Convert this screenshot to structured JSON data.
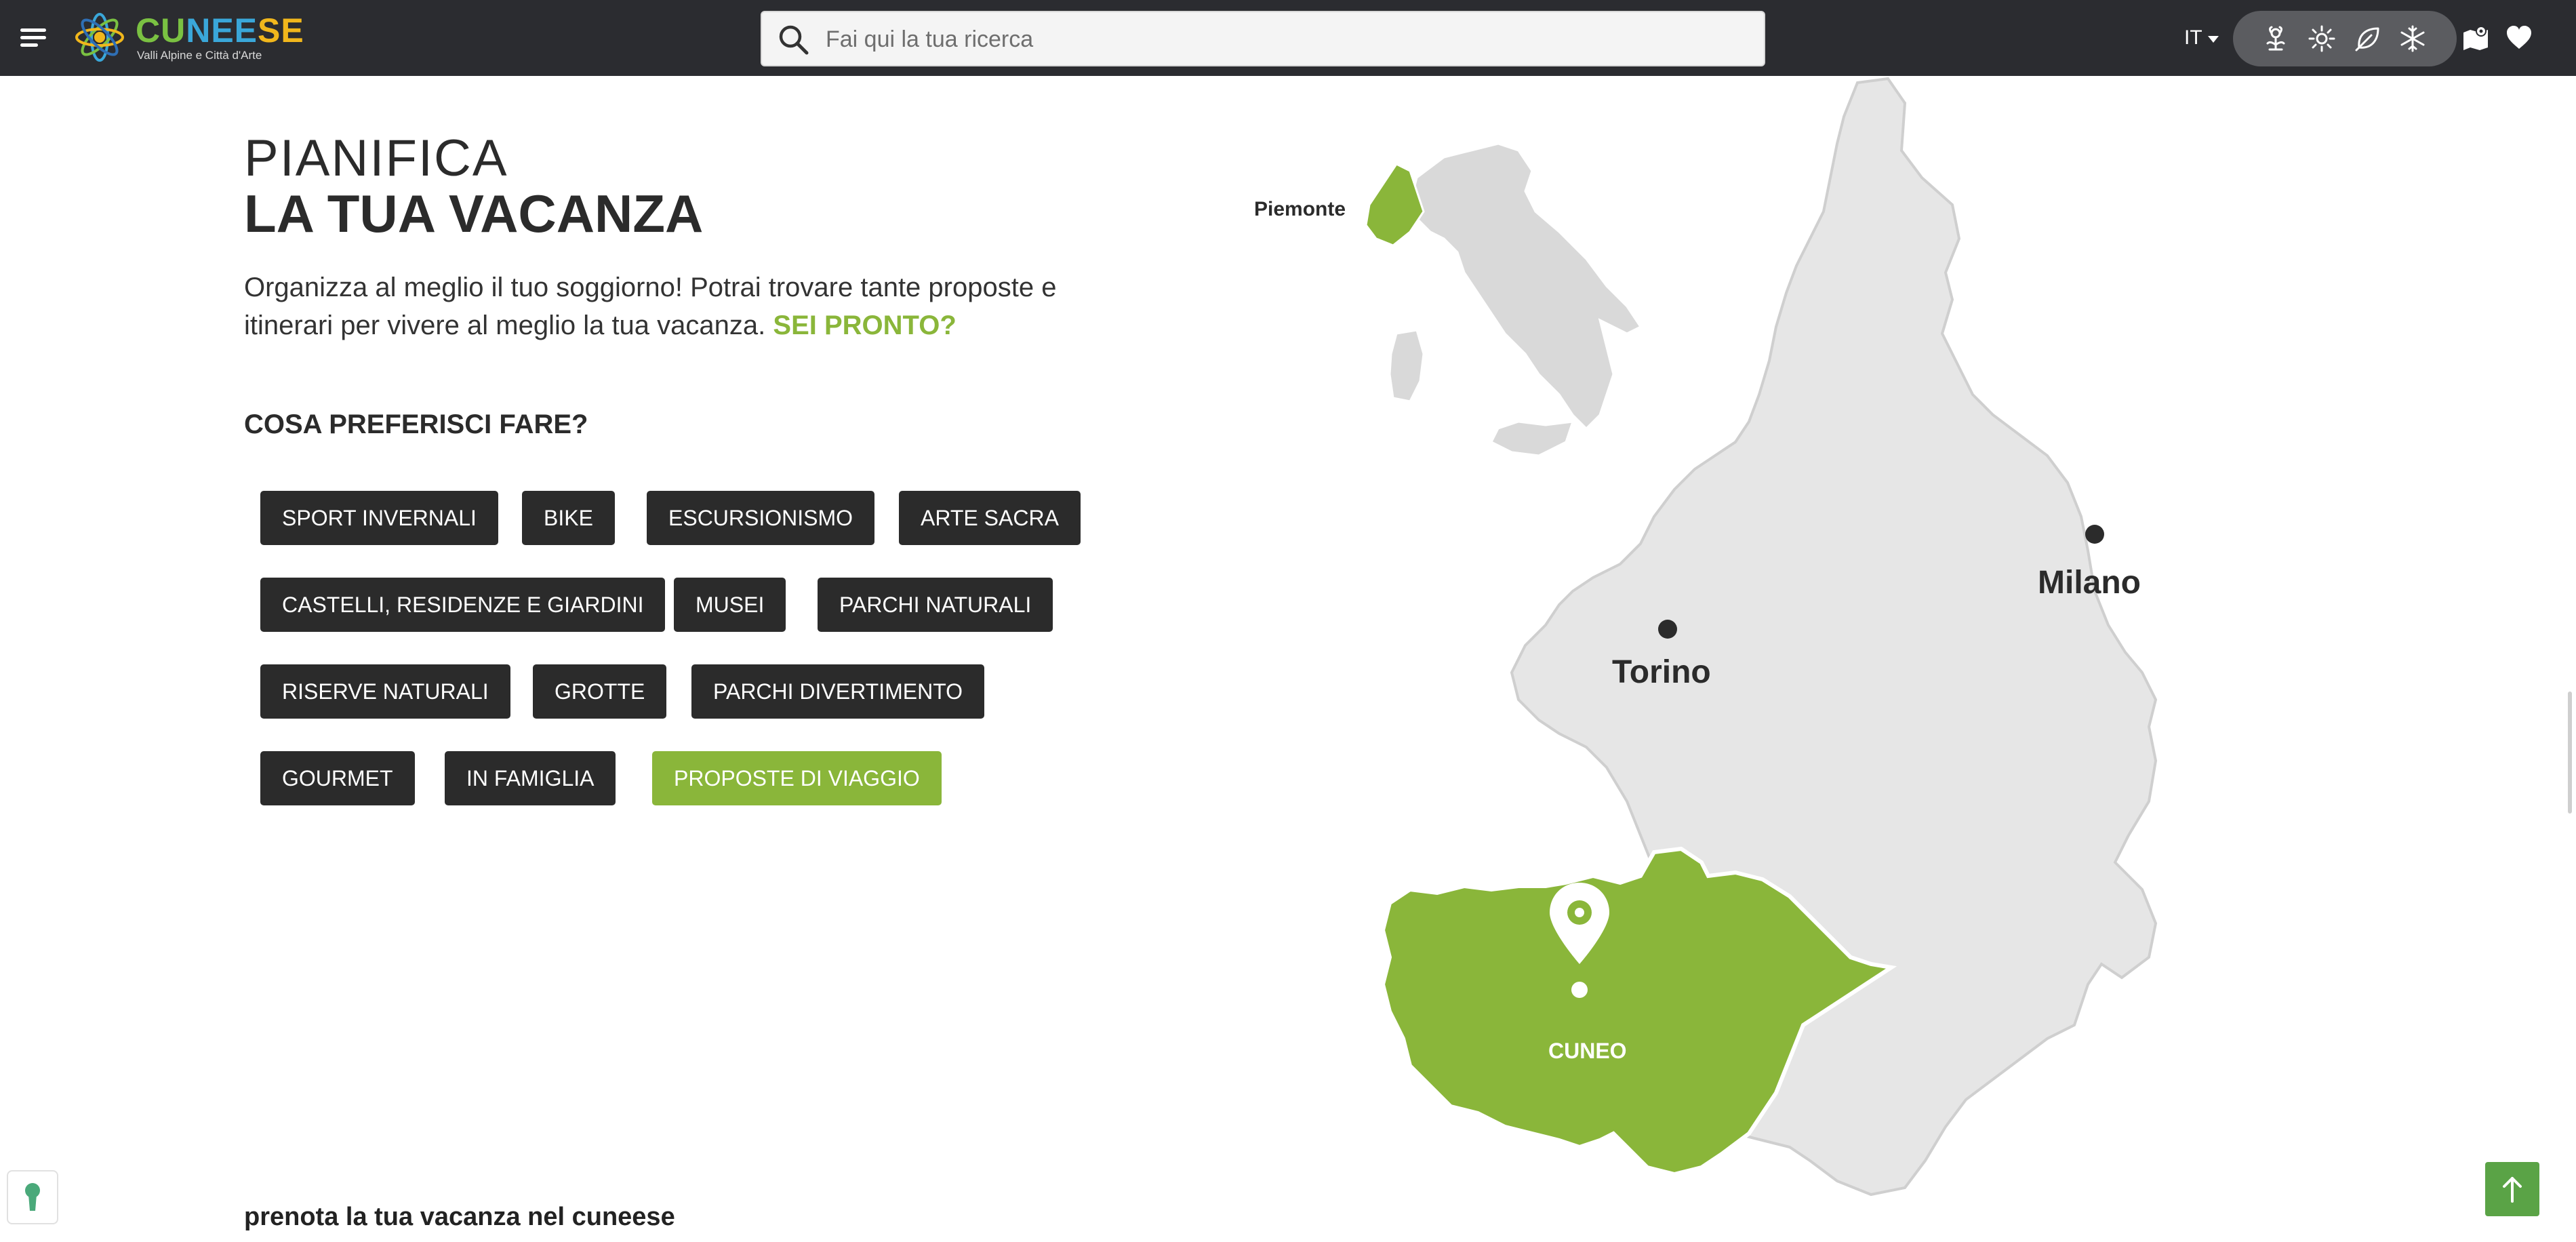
{
  "header": {
    "logo_name_part1": "CU",
    "logo_name_part2": "NEE",
    "logo_name_part3": "SE",
    "logo_subtitle": "Valli Alpine e Città d'Arte",
    "search_placeholder": "Fai qui la tua ricerca",
    "language": "IT",
    "season_icons": [
      "flower-icon",
      "sun-icon",
      "leaf-icon",
      "snowflake-icon"
    ],
    "right_icons": [
      "map-icon",
      "heart-icon"
    ]
  },
  "main": {
    "title_light": "PIANIFICA",
    "title_bold": "LA TUA VACANZA",
    "intro_text": "Organizza al meglio il tuo soggiorno! Potrai trovare tante proposte e itinerari per vivere al meglio la tua vacanza.",
    "intro_highlight": "SEI PRONTO?",
    "question": "COSA PREFERISCI FARE?",
    "categories": [
      {
        "label": "SPORT INVERNALI",
        "active": false
      },
      {
        "label": "BIKE",
        "active": false
      },
      {
        "label": "ESCURSIONISMO",
        "active": false
      },
      {
        "label": "ARTE SACRA",
        "active": false
      },
      {
        "label": "CASTELLI, RESIDENZE E GIARDINI",
        "active": false
      },
      {
        "label": "MUSEI",
        "active": false
      },
      {
        "label": "PARCHI NATURALI",
        "active": false
      },
      {
        "label": "RISERVE NATURALI",
        "active": false
      },
      {
        "label": "GROTTE",
        "active": false
      },
      {
        "label": "PARCHI DIVERTIMENTO",
        "active": false
      },
      {
        "label": "GOURMET",
        "active": false
      },
      {
        "label": "IN FAMIGLIA",
        "active": false
      },
      {
        "label": "PROPOSTE DI VIAGGIO",
        "active": true
      }
    ],
    "booking_title": "prenota la tua vacanza nel cuneese"
  },
  "map": {
    "region_label": "Piemonte",
    "cities": [
      "Torino",
      "Milano"
    ],
    "highlight_label": "CUNEO"
  },
  "colors": {
    "header_bg": "#2b2c30",
    "accent_green": "#8ab63a",
    "tag_bg": "#2b2b2b",
    "map_grey": "#e6e6e6"
  }
}
